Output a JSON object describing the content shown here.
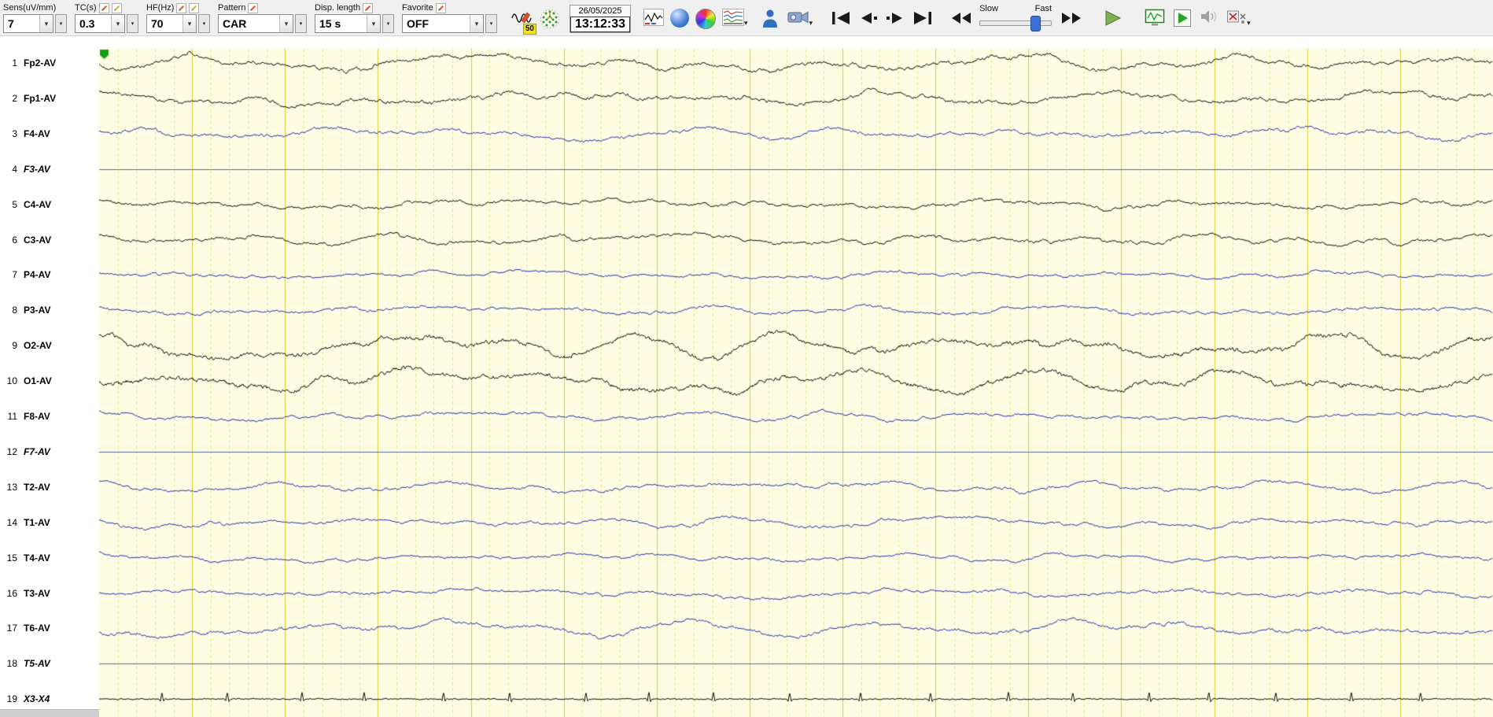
{
  "toolbar": {
    "sens": {
      "label": "Sens(uV/mm)",
      "value": "7"
    },
    "tc": {
      "label": "TC(s)",
      "value": "0.3"
    },
    "hf": {
      "label": "HF(Hz)",
      "value": "70"
    },
    "pattern": {
      "label": "Pattern",
      "value": "CAR"
    },
    "disp_length": {
      "label": "Disp. length",
      "value": "15 s"
    },
    "favorite": {
      "label": "Favorite",
      "value": "OFF"
    },
    "notch_badge": "50",
    "date": "26/05/2025",
    "time": "13:12:33",
    "speed": {
      "slow": "Slow",
      "fast": "Fast",
      "position": 0.78
    }
  },
  "icons": {
    "combo_arrow": "▾",
    "chevron_down": "▾",
    "caret_down": "▾"
  },
  "colors": {
    "background": "#fffce4",
    "grid_major": "#dcc92f",
    "grid_minor": "#ece08e",
    "divider": "#4f6f96",
    "trace_black": "#0a0a0a",
    "trace_blue": "#2430a8",
    "marker_green": "#16a016"
  },
  "display": {
    "seconds": 15,
    "minor_per_second": 5
  },
  "channels": [
    {
      "num": "1",
      "label": "Fp2-AV",
      "italic": false,
      "type": "eeg",
      "color": "black",
      "amp": 13,
      "decay": 0.6,
      "seed": 101
    },
    {
      "num": "2",
      "label": "Fp1-AV",
      "italic": false,
      "type": "eeg",
      "color": "black",
      "amp": 13,
      "decay": 0.6,
      "seed": 202
    },
    {
      "num": "3",
      "label": "F4-AV",
      "italic": false,
      "type": "eeg",
      "color": "blue",
      "amp": 10,
      "decay": 0.64,
      "seed": 303
    },
    {
      "num": "4",
      "label": "F3-AV",
      "italic": true,
      "type": "divider",
      "color": "blue",
      "amp": 0,
      "decay": 0.6,
      "seed": 404
    },
    {
      "num": "5",
      "label": "C4-AV",
      "italic": false,
      "type": "eeg",
      "color": "black",
      "amp": 9,
      "decay": 0.66,
      "seed": 505
    },
    {
      "num": "6",
      "label": "C3-AV",
      "italic": false,
      "type": "eeg",
      "color": "black",
      "amp": 10,
      "decay": 0.66,
      "seed": 606
    },
    {
      "num": "7",
      "label": "P4-AV",
      "italic": false,
      "type": "eeg",
      "color": "blue",
      "amp": 7,
      "decay": 0.66,
      "seed": 707
    },
    {
      "num": "8",
      "label": "P3-AV",
      "italic": false,
      "type": "eeg",
      "color": "blue",
      "amp": 8,
      "decay": 0.66,
      "seed": 808
    },
    {
      "num": "9",
      "label": "O2-AV",
      "italic": false,
      "type": "eeg",
      "color": "black",
      "amp": 18,
      "decay": 0.52,
      "seed": 909
    },
    {
      "num": "10",
      "label": "O1-AV",
      "italic": false,
      "type": "eeg",
      "color": "black",
      "amp": 18,
      "decay": 0.52,
      "seed": 1010
    },
    {
      "num": "11",
      "label": "F8-AV",
      "italic": false,
      "type": "eeg",
      "color": "blue",
      "amp": 8,
      "decay": 0.62,
      "seed": 1111
    },
    {
      "num": "12",
      "label": "F7-AV",
      "italic": true,
      "type": "divider",
      "color": "blue",
      "amp": 0,
      "decay": 0.6,
      "seed": 1212
    },
    {
      "num": "13",
      "label": "T2-AV",
      "italic": false,
      "type": "eeg",
      "color": "blue",
      "amp": 9,
      "decay": 0.62,
      "seed": 1313
    },
    {
      "num": "14",
      "label": "T1-AV",
      "italic": false,
      "type": "eeg",
      "color": "blue",
      "amp": 9,
      "decay": 0.62,
      "seed": 1414
    },
    {
      "num": "15",
      "label": "T4-AV",
      "italic": false,
      "type": "eeg",
      "color": "blue",
      "amp": 7,
      "decay": 0.64,
      "seed": 1515
    },
    {
      "num": "16",
      "label": "T3-AV",
      "italic": false,
      "type": "eeg",
      "color": "blue",
      "amp": 8,
      "decay": 0.62,
      "seed": 1616
    },
    {
      "num": "17",
      "label": "T6-AV",
      "italic": false,
      "type": "eeg",
      "color": "blue",
      "amp": 12,
      "decay": 0.55,
      "seed": 1717
    },
    {
      "num": "18",
      "label": "T5-AV",
      "italic": true,
      "type": "divider",
      "color": "blue",
      "amp": 0,
      "decay": 0.6,
      "seed": 1818
    },
    {
      "num": "19",
      "label": "X3-X4",
      "italic": true,
      "type": "ecg",
      "color": "black",
      "amp": 8,
      "decay": 0.6,
      "seed": 1919
    }
  ]
}
